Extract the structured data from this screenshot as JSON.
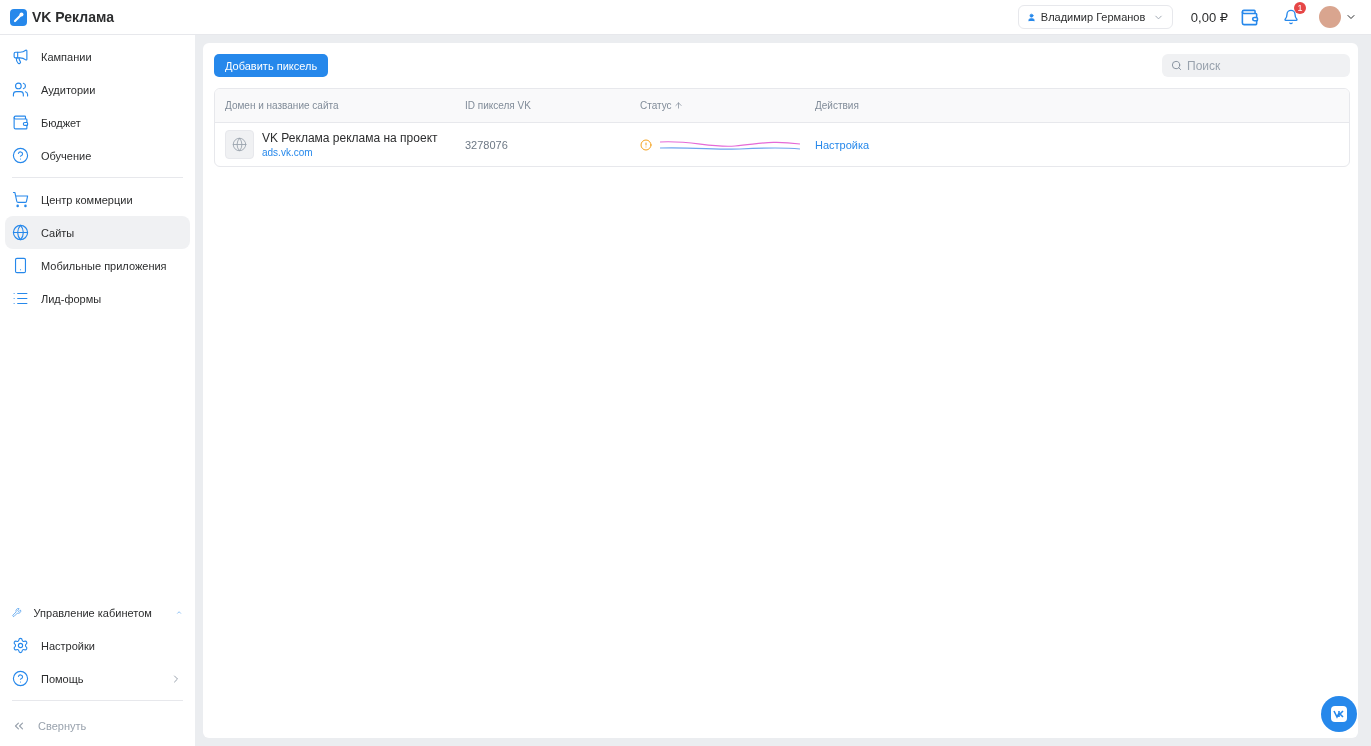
{
  "app": {
    "title": "VK Реклама"
  },
  "header": {
    "account": "Владимир Германов",
    "balance": "0,00 ₽",
    "notifications": "1"
  },
  "sidebar": {
    "groups": [
      {
        "items": [
          {
            "label": "Кампании",
            "selected": false
          },
          {
            "label": "Аудитории",
            "selected": false
          },
          {
            "label": "Бюджет",
            "selected": false
          },
          {
            "label": "Обучение",
            "selected": false
          }
        ]
      },
      {
        "items": [
          {
            "label": "Центр коммерции",
            "selected": false
          },
          {
            "label": "Сайты",
            "selected": true
          },
          {
            "label": "Мобильные приложения",
            "selected": false
          },
          {
            "label": "Лид-формы",
            "selected": false
          }
        ]
      }
    ],
    "bottom": [
      {
        "label": "Управление кабинетом",
        "kind": "expandable",
        "expanded": true
      },
      {
        "label": "Настройки",
        "kind": "plain"
      },
      {
        "label": "Помощь",
        "kind": "submenu"
      }
    ],
    "collapse": "Свернуть"
  },
  "toolbar": {
    "add_button": "Добавить пиксель",
    "search": {
      "placeholder": "Поиск"
    }
  },
  "table": {
    "columns": [
      {
        "label": "Домен и название сайта",
        "sorted": false
      },
      {
        "label": "ID пикселя VK",
        "sorted": false
      },
      {
        "label": "Статус",
        "sorted": true
      },
      {
        "label": "Действия",
        "sorted": false
      }
    ],
    "rows": [
      {
        "name": "VK Реклама реклама на проект",
        "domain": "ads.vk.com",
        "pixel_id": "3278076",
        "warning": true,
        "action": "Настройка"
      }
    ]
  }
}
